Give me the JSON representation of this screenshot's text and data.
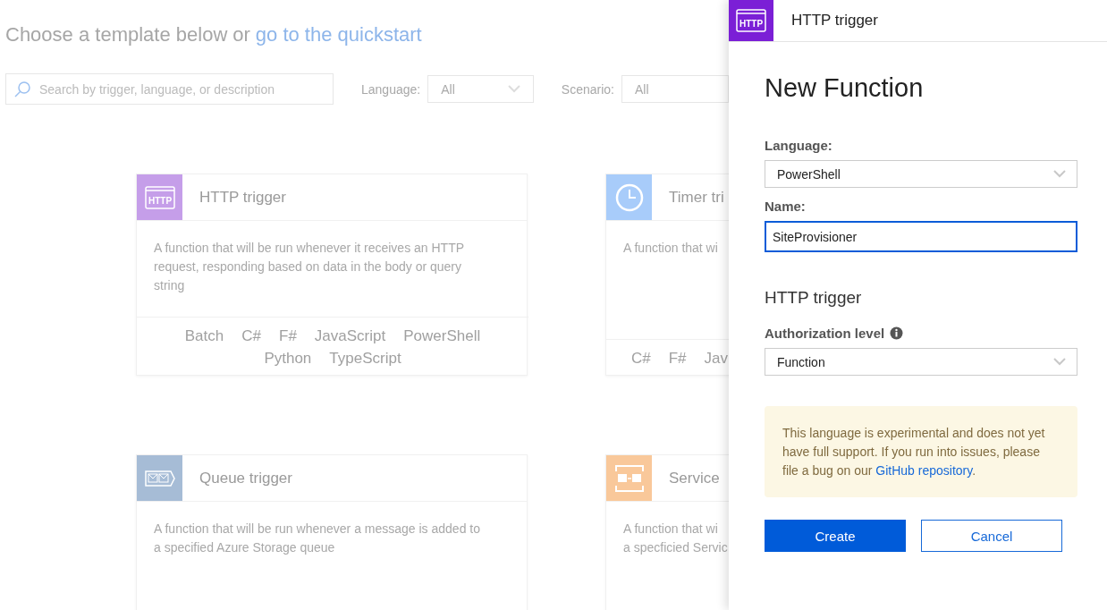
{
  "page": {
    "heading": "Choose a template below",
    "heading_joiner": "or",
    "quickstart_link": "go to the quickstart"
  },
  "filters": {
    "search": {
      "placeholder": "Search by trigger, language, or description"
    },
    "language": {
      "label": "Language:",
      "value": "All"
    },
    "scenario": {
      "label": "Scenario:",
      "value": "All"
    }
  },
  "cards": [
    {
      "kind": "http",
      "color": "#c59ee9",
      "icon_text": "HTTP",
      "title": "HTTP trigger",
      "description": "A function that will be run whenever it receives an HTTP request, responding based on data in the body or query string",
      "languages": [
        "Batch",
        "C#",
        "F#",
        "JavaScript",
        "PowerShell",
        "Python",
        "TypeScript"
      ]
    },
    {
      "kind": "clock",
      "color": "#a8ccfa",
      "title": "Timer tri",
      "description": "A function that wi",
      "languages": [
        "C#",
        "F#",
        "Jav"
      ]
    },
    {
      "kind": "queue",
      "color": "#a6bcd6",
      "title": "Queue trigger",
      "description": "A function that will be run whenever a message is added to a specified Azure Storage queue"
    },
    {
      "kind": "servicebus",
      "color": "#f9c89a",
      "title": "Service",
      "description": "A function that wi\na specficied Servic"
    }
  ],
  "panel": {
    "icon_text": "HTTP",
    "header_title": "HTTP trigger",
    "heading": "New Function",
    "language": {
      "label": "Language:",
      "value": "PowerShell"
    },
    "name": {
      "label": "Name:",
      "value": "SiteProvisioner",
      "focused": true
    },
    "section_title": "HTTP trigger",
    "authorization": {
      "label": "Authorization level",
      "value": "Function"
    },
    "warning": {
      "text": "This language is experimental and does not yet have full support. If you run into issues, please file a bug on our",
      "link": "GitHub repository",
      "trailing": "."
    },
    "buttons": [
      {
        "label": "Create",
        "primary": true
      },
      {
        "label": "Cancel",
        "primary": false
      }
    ]
  }
}
